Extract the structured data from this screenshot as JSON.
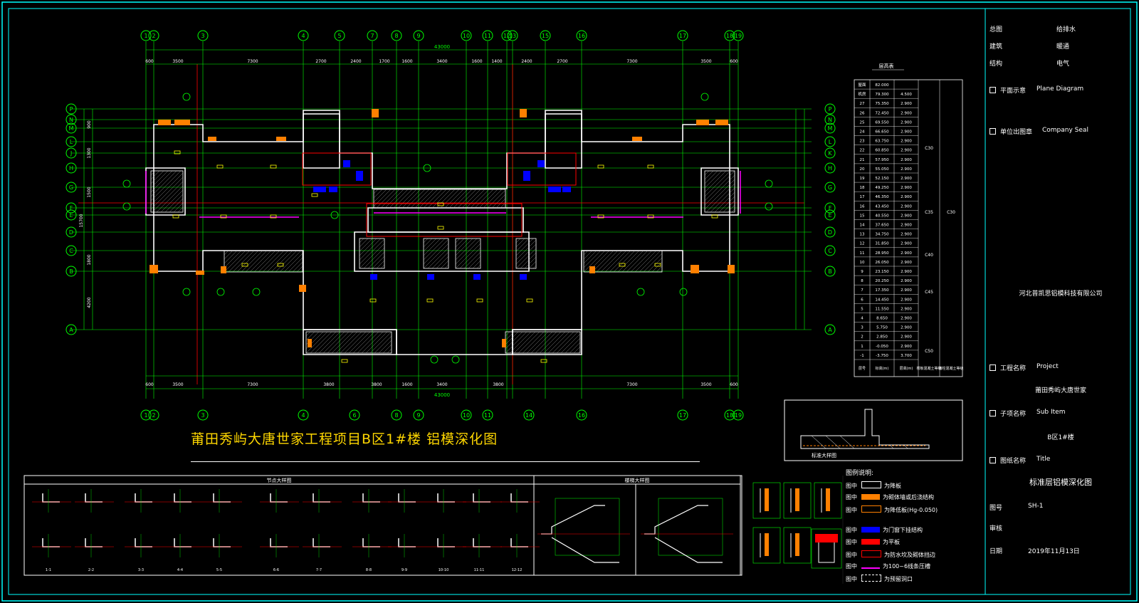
{
  "drawing": {
    "title": "莆田秀屿大唐世家工程项目B区1#楼 铝模深化图",
    "top_axes": [
      "1",
      "2",
      "3",
      "4",
      "5",
      "7",
      "8",
      "9",
      "10",
      "11",
      "12",
      "13",
      "15",
      "16",
      "17",
      "18",
      "19"
    ],
    "bottom_axes": [
      "1",
      "2",
      "3",
      "4",
      "6",
      "8",
      "9",
      "10",
      "11",
      "14",
      "16",
      "17",
      "18",
      "19"
    ],
    "row_axes": [
      "P",
      "N",
      "M",
      "L",
      "J",
      "H",
      "G",
      "F",
      "E",
      "D",
      "C",
      "B",
      "A"
    ],
    "right_row_axes": [
      "P",
      "N",
      "M",
      "L",
      "K",
      "H",
      "G",
      "F",
      "E",
      "D",
      "C",
      "B",
      "A"
    ],
    "top_dims": [
      "600",
      "3500",
      "7300",
      "2700",
      "2400",
      "1700",
      "1600",
      "3400",
      "1600",
      "1400",
      "2400",
      "2700",
      "7300",
      "3500",
      "600"
    ],
    "bottom_dims": [
      "600",
      "3500",
      "7300",
      "3800",
      "3800",
      "1600",
      "3400",
      "3800",
      "7300",
      "3500",
      "600"
    ],
    "total_width": "43000",
    "left_dims": [
      "900",
      "1300",
      "1500",
      "1800",
      "4200"
    ],
    "total_depth": "15700"
  },
  "floor_table": {
    "title": "层高表",
    "header": [
      "层号",
      "标高(m)",
      "层高(m)",
      "楼板混凝土等级",
      "墙柱混凝土等级"
    ],
    "rows": [
      [
        "屋面",
        "82.000",
        ""
      ],
      [
        "机房",
        "79.300",
        "4.500"
      ],
      [
        "27",
        "75.350",
        "2.900"
      ],
      [
        "26",
        "72.450",
        "2.900"
      ],
      [
        "25",
        "69.550",
        "2.900"
      ],
      [
        "24",
        "66.650",
        "2.900"
      ],
      [
        "23",
        "63.750",
        "2.900"
      ],
      [
        "22",
        "60.850",
        "2.900"
      ],
      [
        "21",
        "57.950",
        "2.900"
      ],
      [
        "20",
        "55.050",
        "2.900"
      ],
      [
        "19",
        "52.150",
        "2.900"
      ],
      [
        "18",
        "49.250",
        "2.900"
      ],
      [
        "17",
        "46.350",
        "2.900"
      ],
      [
        "16",
        "43.450",
        "2.900"
      ],
      [
        "15",
        "40.550",
        "2.900"
      ],
      [
        "14",
        "37.650",
        "2.900"
      ],
      [
        "13",
        "34.750",
        "2.900"
      ],
      [
        "12",
        "31.850",
        "2.900"
      ],
      [
        "11",
        "28.950",
        "2.900"
      ],
      [
        "10",
        "26.050",
        "2.900"
      ],
      [
        "9",
        "23.150",
        "2.900"
      ],
      [
        "8",
        "20.250",
        "2.900"
      ],
      [
        "7",
        "17.350",
        "2.900"
      ],
      [
        "6",
        "14.450",
        "2.900"
      ],
      [
        "5",
        "11.550",
        "2.900"
      ],
      [
        "4",
        "8.650",
        "2.900"
      ],
      [
        "3",
        "5.750",
        "2.900"
      ],
      [
        "2",
        "2.850",
        "2.900"
      ],
      [
        "1",
        "-0.050",
        "2.900"
      ],
      [
        "-1",
        "-3.750",
        "3.700"
      ]
    ],
    "grades_slab": [
      "C30",
      "C35",
      "C40",
      "C45",
      "C50"
    ],
    "grade_wall": "C30"
  },
  "section_detail_label": "标准大样图",
  "node_detail": {
    "title": "节点大样图",
    "labels": [
      "1-1",
      "2-2",
      "3-3",
      "4-4",
      "5-5",
      "6-6",
      "7-7",
      "8-8",
      "9-9",
      "10-10",
      "11-11",
      "12-12"
    ]
  },
  "stair_detail": {
    "title": "楼梯大样图"
  },
  "legend": {
    "title": "图例说明:",
    "items": [
      {
        "key": "图中",
        "text": "为降板",
        "color": "#ffffff"
      },
      {
        "key": "图中",
        "text": "为砌体墙或后浇结构",
        "color": "#ff8000"
      },
      {
        "key": "图中",
        "text": "为降低板(Hg-0.050)",
        "color": "#ff8000"
      },
      {
        "key": "图中",
        "text": "为门窗下挂结构",
        "color": "#0000ff"
      },
      {
        "key": "图中",
        "text": "为平板",
        "color": "#ff0000"
      },
      {
        "key": "图中",
        "text": "为防水坎及砌体挡边",
        "color": "#ff0000"
      },
      {
        "key": "图中",
        "text": "为100~6线条压槽",
        "color": "#ff00ff"
      },
      {
        "key": "图中",
        "text": "为预留洞口",
        "color": "#ffffff"
      }
    ]
  },
  "title_block": {
    "rows": [
      {
        "label": "总图",
        "value": "给排水"
      },
      {
        "label": "建筑",
        "value": "暖通"
      },
      {
        "label": "结构",
        "value": "电气"
      }
    ],
    "plane_diagram": {
      "cn": "平面示意",
      "en": "Plane Diagram"
    },
    "company_seal": {
      "cn": "单位出图章",
      "en": "Company Seal"
    },
    "company_name": "河北普凯思铝模科技有限公司",
    "project": {
      "cn": "工程名称",
      "en": "Project",
      "value": "莆田秀屿大唐世家"
    },
    "sub_item": {
      "cn": "子项名称",
      "en": "Sub Item",
      "value": "B区1#楼"
    },
    "title": {
      "cn": "图纸名称",
      "en": "Title",
      "value": "标准层铝模深化图"
    },
    "drawing_no": {
      "label": "图号",
      "value": "SH-1"
    },
    "review": {
      "label": "审核",
      "value": ""
    },
    "date": {
      "label": "日期",
      "value": "2019年11月13日"
    }
  },
  "colors": {
    "background": "#000000",
    "grid": "#00ff00",
    "axis_line": "#ff0000",
    "wall": "#ffffff",
    "highlight": "#ff8000",
    "title_text": "#ffd700",
    "frame": "#00ffff"
  }
}
